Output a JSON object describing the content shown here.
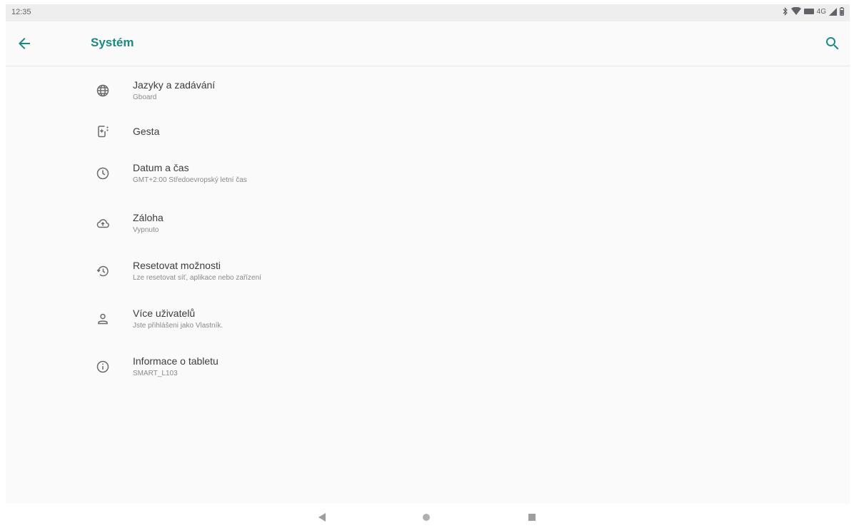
{
  "status_bar": {
    "time": "12:35",
    "network_type": "4G",
    "icons": [
      "bluetooth-icon",
      "wifi-icon",
      "network-badge-icon",
      "signal-icon",
      "battery-icon"
    ]
  },
  "app_bar": {
    "title": "Systém",
    "back_icon": "arrow-back-icon",
    "search_icon": "search-icon"
  },
  "colors": {
    "accent": "#1a8a80",
    "background": "#fafafa",
    "text_primary": "#3c3c3c",
    "text_secondary": "#8a8a8a"
  },
  "settings": [
    {
      "id": "languages",
      "icon": "globe-icon",
      "label": "Jazyky a zadávání",
      "summary": "Gboard"
    },
    {
      "id": "gestures",
      "icon": "gestures-icon",
      "label": "Gesta",
      "summary": ""
    },
    {
      "id": "datetime",
      "icon": "clock-icon",
      "label": "Datum a čas",
      "summary": "GMT+2:00 Středoevropský letní čas"
    },
    {
      "id": "backup",
      "icon": "cloud-upload-icon",
      "label": "Záloha",
      "summary": "Vypnuto"
    },
    {
      "id": "reset",
      "icon": "history-icon",
      "label": "Resetovat možnosti",
      "summary": "Lze resetovat síť, aplikace nebo zařízení"
    },
    {
      "id": "users",
      "icon": "person-icon",
      "label": "Více uživatelů",
      "summary": "Jste přihlášeni jako Vlastník."
    },
    {
      "id": "about",
      "icon": "info-icon",
      "label": "Informace o tabletu",
      "summary": "SMART_L103"
    }
  ],
  "nav_bar": {
    "back_icon": "nav-back-icon",
    "home_icon": "nav-home-icon",
    "recents_icon": "nav-recents-icon"
  }
}
